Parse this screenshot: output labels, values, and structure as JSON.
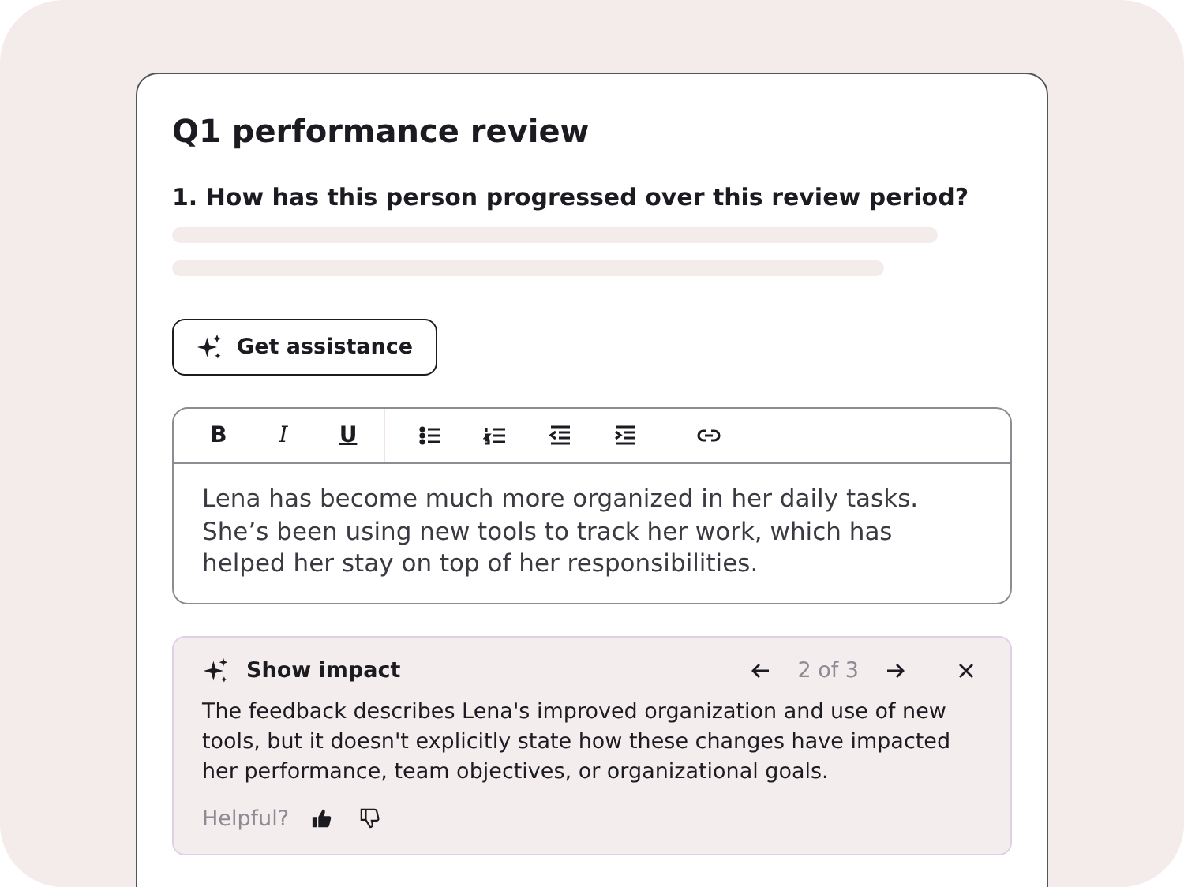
{
  "title": "Q1 performance review",
  "question": "1. How has this person progressed over this review period?",
  "assist_button": "Get assistance",
  "toolbar": [
    {
      "kind": "bold",
      "label": "B"
    },
    {
      "kind": "italic",
      "label": "I"
    },
    {
      "kind": "underline",
      "label": "U"
    },
    {
      "kind": "divider"
    },
    {
      "kind": "bullets"
    },
    {
      "kind": "numbers"
    },
    {
      "kind": "outdent"
    },
    {
      "kind": "indent"
    },
    {
      "kind": "link"
    }
  ],
  "editor_text": "Lena has become much more organized in her daily tasks. She’s been using new tools to track her work, which has helped her stay on top of her responsibilities.",
  "suggestion": {
    "title": "Show impact",
    "pager": "2 of 3",
    "body": "The feedback describes Lena's improved organization and use of new tools, but it doesn't explicitly state how these changes have impacted her performance, team objectives, or organizational goals.",
    "helpful_label": "Helpful?"
  }
}
